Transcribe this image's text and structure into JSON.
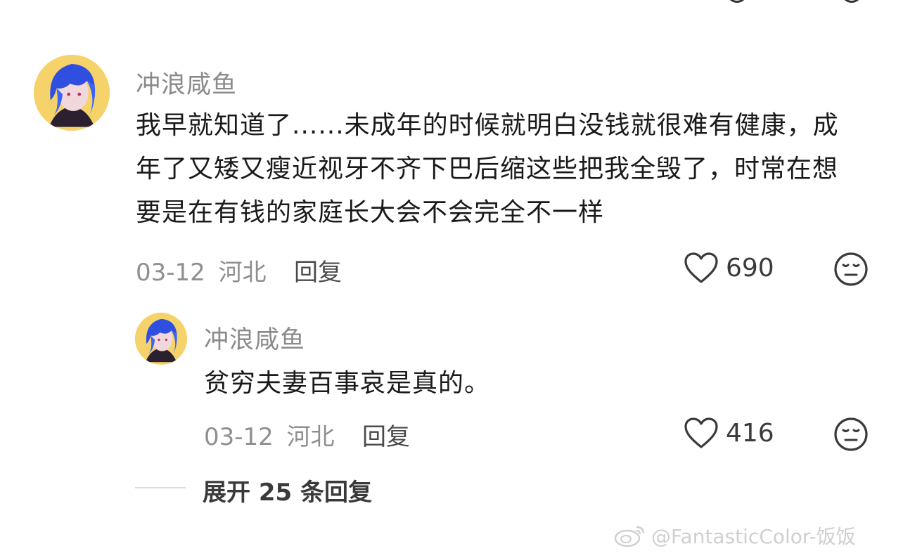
{
  "comment": {
    "username": "冲浪咸鱼",
    "content": "我早就知道了......未成年的时候就明白没钱就很难有健康，成年了又矮又瘦近视牙不齐下巴后缩这些把我全毁了，时常在想要是在有钱的家庭长大会不会完全不一样",
    "date": "03-12",
    "location": "河北",
    "reply_label": "回复",
    "likes": "690"
  },
  "reply": {
    "username": "冲浪咸鱼",
    "content": "贫穷夫妻百事哀是真的。",
    "date": "03-12",
    "location": "河北",
    "reply_label": "回复",
    "likes": "416"
  },
  "expand_label": "展开 25 条回复",
  "watermark": "@FantasticColor-饭饭",
  "icons": {
    "like": "heart-outline-icon",
    "dislike": "neutral-face-icon",
    "watermark": "weibo-logo-icon"
  },
  "colors": {
    "username": "#8a8a8a",
    "meta": "#8f8f8f",
    "avatar_bg": "#f6d36a",
    "avatar_hair": "#2f4fe0"
  }
}
